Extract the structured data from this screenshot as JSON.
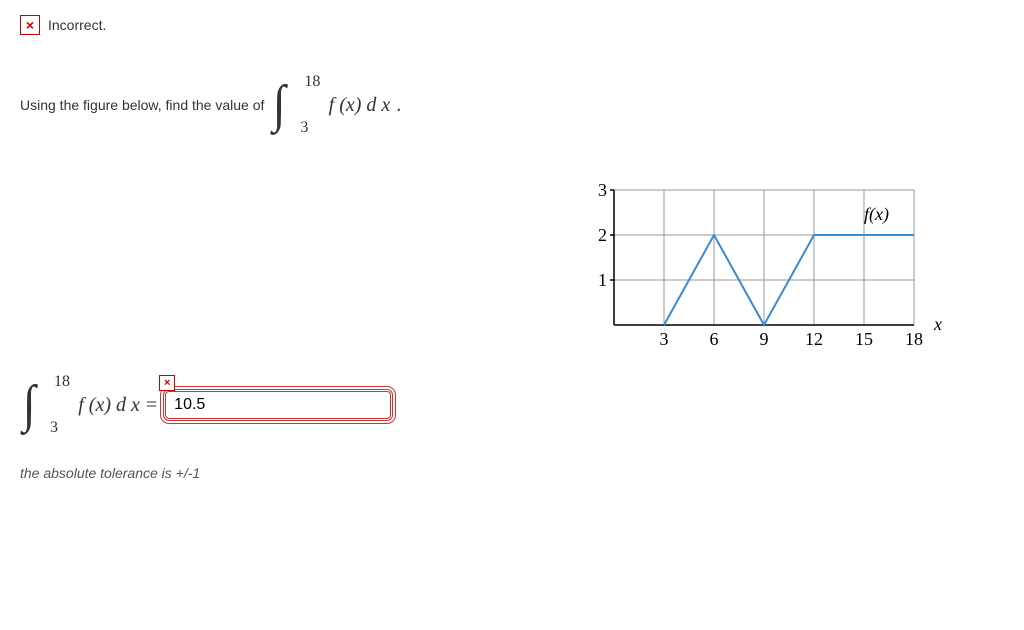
{
  "status": {
    "icon_glyph": "×",
    "label": "Incorrect."
  },
  "prompt": {
    "lead_text": "Using the figure below, find the value of",
    "integral_upper": "18",
    "integral_lower": "3",
    "integrand": "f (x) d x",
    "trail": "."
  },
  "answer": {
    "integral_upper": "18",
    "integral_lower": "3",
    "integrand": "f (x) d x",
    "equals": "=",
    "value": "10.5",
    "err_glyph": "×"
  },
  "tolerance_text": "the absolute tolerance is +/-1",
  "chart_data": {
    "type": "line",
    "series": [
      {
        "name": "f(x)",
        "points": [
          [
            3,
            0
          ],
          [
            6,
            2
          ],
          [
            9,
            0
          ],
          [
            12,
            2
          ],
          [
            18,
            2
          ]
        ]
      }
    ],
    "x_ticks": [
      3,
      6,
      9,
      12,
      15,
      18
    ],
    "y_ticks": [
      1,
      2,
      3
    ],
    "xlabel": "x",
    "fn_label": "f(x)",
    "xlim": [
      0,
      18
    ],
    "ylim": [
      0,
      3
    ]
  }
}
